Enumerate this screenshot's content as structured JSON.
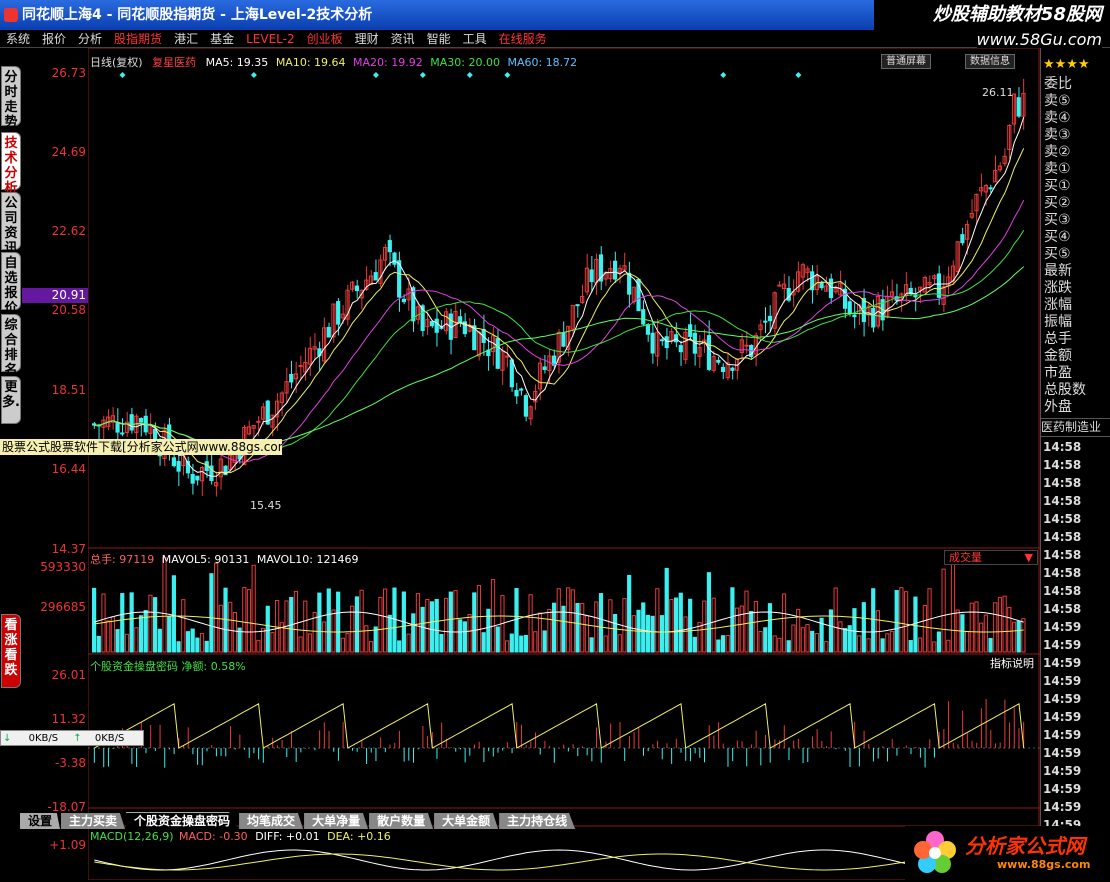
{
  "titlebar": {
    "title": "同花顺上海4 - 同花顺股指期货 - 上海Level-2技术分析",
    "brand": "炒股辅助教材58股网"
  },
  "menu": [
    "系统",
    "报价",
    "分析",
    "股指期货",
    "港汇",
    "基金",
    "LEVEL-2",
    "创业板",
    "理财",
    "资讯",
    "智能",
    "工具",
    "在线服务"
  ],
  "menu_red": [
    3,
    6,
    7,
    12
  ],
  "domain_url": "www.58Gu.com",
  "left_tabs": [
    "分时走势",
    "技术分析",
    "公司资讯",
    "自选报价",
    "综合排名",
    "更多..."
  ],
  "bottom_left_tab": "看涨看跌",
  "price_axis": {
    "ticks": [
      "26.73",
      "24.69",
      "22.62",
      "20.91",
      "20.58",
      "18.51",
      "16.44",
      "14.37"
    ],
    "current": "20.91"
  },
  "kline_legend": {
    "period": "日线(复权)",
    "stock": "复星医药",
    "ma5": "MA5: 19.35",
    "ma10": "MA10: 19.64",
    "ma20": "MA20: 19.92",
    "ma30": "MA30: 20.00",
    "ma60": "MA60: 18.72"
  },
  "annotations": {
    "high": "26.11",
    "low": "15.45"
  },
  "volume": {
    "legend_total": "总手: 97119",
    "mavol5": "MAVOL5: 90131",
    "mavol10": "MAVOL10: 121469",
    "dropdown": "成交量",
    "ticks": [
      "593330",
      "296685"
    ]
  },
  "indicator": {
    "legend": "个股资金操盘密码 净额: 0.58%",
    "help": "指标说明",
    "ticks": [
      "26.01",
      "11.32",
      "-3.38",
      "-18.07"
    ]
  },
  "macd": {
    "legend_name": "MACD(12,26,9)",
    "macd": "MACD: -0.30",
    "diff": "DIFF: +0.01",
    "dea": "DEA: +0.16",
    "tick": "+1.09"
  },
  "overlay_ad": "股票公式股票软件下载[分析家公式网www.88gs.com]",
  "kbs": {
    "down": "0KB/S",
    "up": "0KB/S"
  },
  "bottom_tabs": [
    "设置",
    "主力买卖",
    "个股资金操盘密码",
    "均笔成交",
    "大单净量",
    "散户数量",
    "大单金额",
    "主力持仓线"
  ],
  "bottom_tab_active": 2,
  "right_panel": {
    "top_buttons": [
      "普通屏幕",
      "数据信息"
    ],
    "stars": "★★★★",
    "items": [
      "委比",
      "卖⑤",
      "卖④",
      "卖③",
      "卖②",
      "卖①",
      "买①",
      "买②",
      "买③",
      "买④",
      "买⑤",
      "最新",
      "涨跌",
      "涨幅",
      "振幅",
      "总手",
      "金额",
      "市盈",
      "总股数",
      "外盘"
    ],
    "industry": "医药制造业",
    "times": [
      "14:58",
      "14:58",
      "14:58",
      "14:58",
      "14:58",
      "14:58",
      "14:58",
      "14:58",
      "14:58",
      "14:58",
      "14:59",
      "14:59",
      "14:59",
      "14:59",
      "14:59",
      "14:59",
      "14:59",
      "14:59",
      "14:59",
      "14:59",
      "14:59",
      "14:59"
    ]
  },
  "bottom_logo": {
    "name": "分析家公式网",
    "url": "www.88gs.com"
  },
  "colors": {
    "up": "#e83a3a",
    "down": "#3af0f0",
    "ma5": "#ffffff",
    "ma10": "#f0f060",
    "ma20": "#e040e0",
    "ma30": "#40e040",
    "ma60": "#60ff60",
    "axis": "#e33333"
  }
}
